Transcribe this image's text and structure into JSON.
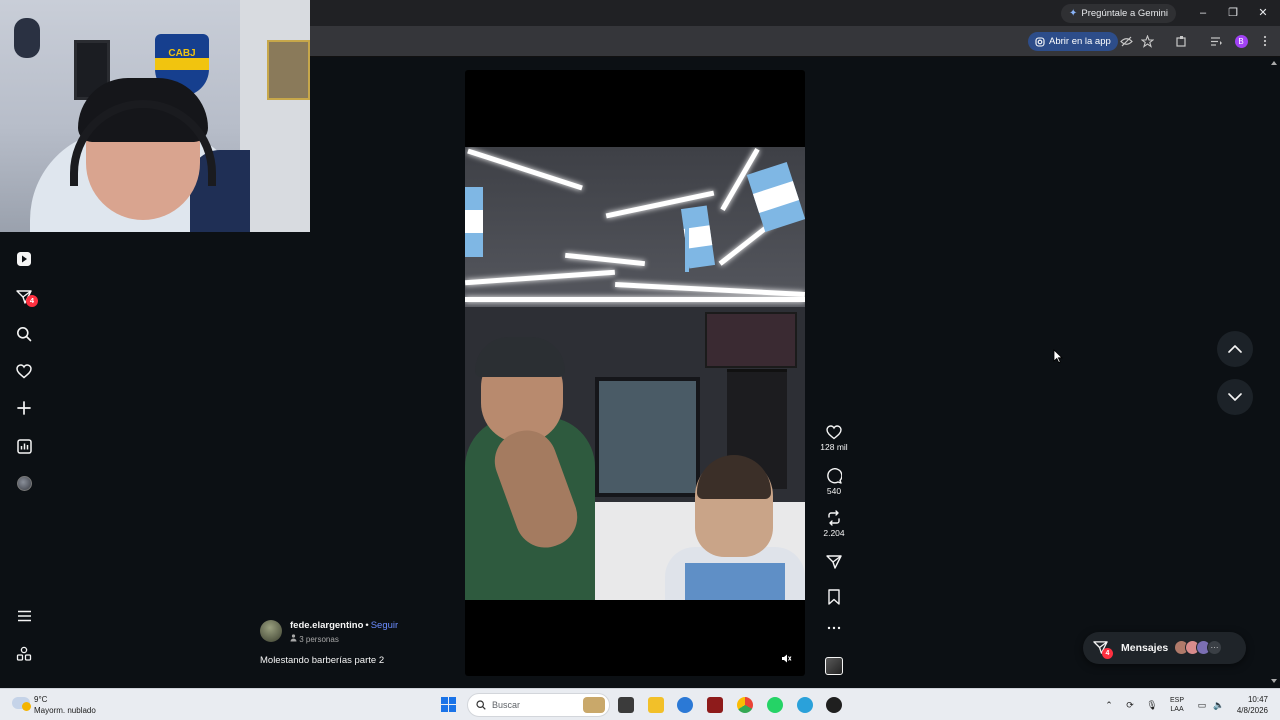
{
  "browser": {
    "gemini_label": "Pregúntale a Gemini",
    "open_app_label": "Abrir en la app",
    "profile_initial": "B"
  },
  "webcam": {
    "crest_text": "CABJ"
  },
  "sidebar": {
    "notifications_badge": "4",
    "items": [
      {
        "icon": "reels-icon"
      },
      {
        "icon": "direct-icon"
      },
      {
        "icon": "search-icon"
      },
      {
        "icon": "heart-icon"
      },
      {
        "icon": "plus-icon"
      },
      {
        "icon": "dashboard-icon"
      },
      {
        "icon": "profile-avatar"
      },
      {
        "icon": "menu-icon"
      },
      {
        "icon": "apps-icon"
      }
    ]
  },
  "reel": {
    "author": "fede.elargentino",
    "separator": "•",
    "follow_label": "Seguir",
    "collaborators": "3 personas",
    "caption": "Molestando barberías parte 2",
    "actions": {
      "likes": "128 mil",
      "comments": "540",
      "reposts": "2.204"
    }
  },
  "messages": {
    "label": "Mensajes",
    "badge": "4",
    "avatar_colors": [
      "#b07a6a",
      "#d98c8c",
      "#7b6fb3"
    ]
  },
  "taskbar": {
    "temperature": "9°C",
    "condition": "Mayorm. nublado",
    "search_placeholder": "Buscar",
    "lang_line1": "ESP",
    "lang_line2": "LAA",
    "time": "10:47",
    "date": "4/8/2026"
  },
  "colors": {
    "background": "#0c1014",
    "accent_link": "#6b8cff",
    "badge": "#ff3040"
  }
}
